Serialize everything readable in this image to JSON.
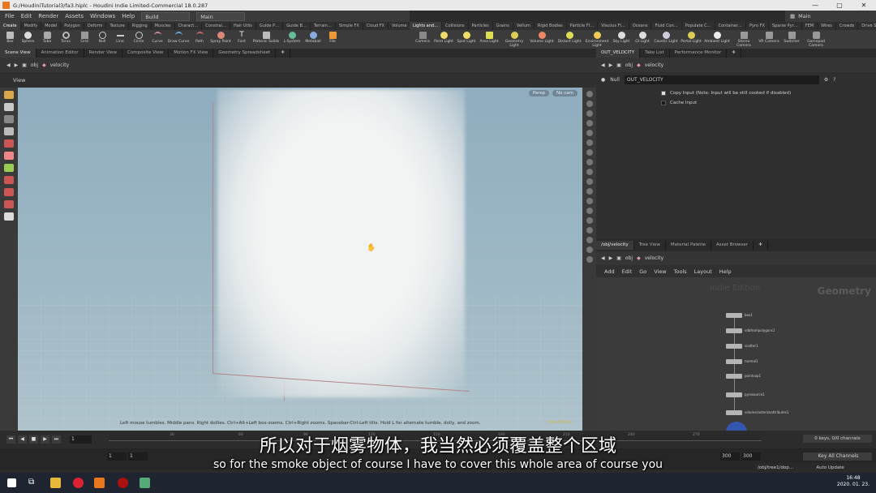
{
  "window": {
    "path": "G:/HoudiniTutorial3/fa3.hiplc",
    "title": "Houdini Indie Limited-Commercial 18.0.287",
    "controls": [
      "—",
      "▢",
      "✕"
    ]
  },
  "menubar": {
    "items": [
      "File",
      "Edit",
      "Render",
      "Assets",
      "Windows",
      "Help"
    ],
    "build": "Build",
    "main": "Main"
  },
  "desktop": {
    "name": "Main"
  },
  "shelf_tabs_left": [
    "Create",
    "Modify",
    "Model",
    "Polygon",
    "Deform",
    "Texture",
    "Rigging",
    "Muscles",
    "Charact…",
    "Constrai…",
    "Hair Utils",
    "Guide P…",
    "Guide B…",
    "Terrain…",
    "Simple FX",
    "Cloud FX",
    "Volume"
  ],
  "shelf_tabs_right": [
    "Lights and…",
    "Collisions",
    "Particles",
    "Grains",
    "Vellum",
    "Rigid Bodies",
    "Particle Fl…",
    "Viscous Fl…",
    "Oceans",
    "Fluid Con…",
    "Populate C…",
    "Container…",
    "Pyro FX",
    "Sparse Pyr…",
    "FEM",
    "Wires",
    "Crowds",
    "Drive Sim…"
  ],
  "shelf_tools_left": [
    "Box",
    "Sphere",
    "Tube",
    "Torus",
    "Grid",
    "Null",
    "Line",
    "Circle",
    "Curve",
    "Draw Curve",
    "Path",
    "Spray Paint",
    "Font",
    "Platonic Solids",
    "L-System",
    "Metaball",
    "File"
  ],
  "shelf_tools_right": [
    "Camera",
    "Point Light",
    "Spot Light",
    "Area Light",
    "Geometry Light",
    "Volume Light",
    "Distant Light",
    "Environment Light",
    "Sky Light",
    "GI Light",
    "Caustic Light",
    "Portal Light",
    "Ambient Light",
    "Stereo Camera",
    "VR Camera",
    "Switcher",
    "Gamepad Camera"
  ],
  "pane_tabs_left": [
    "Scene View",
    "Animation Editor",
    "Render View",
    "Composite View",
    "Motion FX View",
    "Geometry Spreadsheet"
  ],
  "path_left": {
    "root": "obj",
    "node": "velocity"
  },
  "viewport": {
    "title": "View",
    "persp": "Persp",
    "cam": "No cam",
    "help": "Left mouse tumbles. Middle pans. Right dollies. Ctrl+Alt+Left box-zooms. Ctrl+Right zooms. Spacebar-Ctrl-Left tilts. Hold L for alternate tumble, dolly, and zoom.",
    "edition": "Indie Edition"
  },
  "pane_tabs_right": [
    "OUT_VELOCITY",
    "Take List",
    "Performance Monitor"
  ],
  "path_right": {
    "root": "obj",
    "node": "velocity"
  },
  "params": {
    "type": "Null",
    "name": "OUT_VELOCITY",
    "rows": [
      {
        "label": "Copy Input (Note: Input will be still cooked if disabled)",
        "checked": true
      },
      {
        "label": "Cache Input",
        "checked": false
      }
    ]
  },
  "net_tabs": [
    "/obj/velocity",
    "Tree View",
    "Material Palette",
    "Asset Browser"
  ],
  "net_path": {
    "root": "obj",
    "node": "velocity"
  },
  "net_menu": [
    "Add",
    "Edit",
    "Go",
    "View",
    "Tools",
    "Layout",
    "Help"
  ],
  "network": {
    "edition": "Indie Edition",
    "context": "Geometry",
    "nodes": [
      "box1",
      "vdbfrompolygons1",
      "scatter1",
      "normal1",
      "pointvop1",
      "pyrosource1",
      "volumerasterizeattributes1"
    ]
  },
  "timeline": {
    "frame": "1",
    "ticks": [
      "30",
      "60",
      "90",
      "120",
      "150",
      "180",
      "210",
      "240",
      "270"
    ],
    "keys": "0 keys, 0/0 channels",
    "keyall": "Key All Channels",
    "start": "1",
    "start2": "1",
    "end": "300",
    "end2": "300",
    "auto": "Auto Update",
    "path": "/obj/tree1/dop…"
  },
  "subtitle": {
    "cn": "所以对于烟雾物体，我当然必须覆盖整个区域",
    "en": "so for the smoke object of course I have to cover this whole area of course you"
  },
  "taskbar": {
    "time": "16:48",
    "date": "2020. 01. 23."
  }
}
